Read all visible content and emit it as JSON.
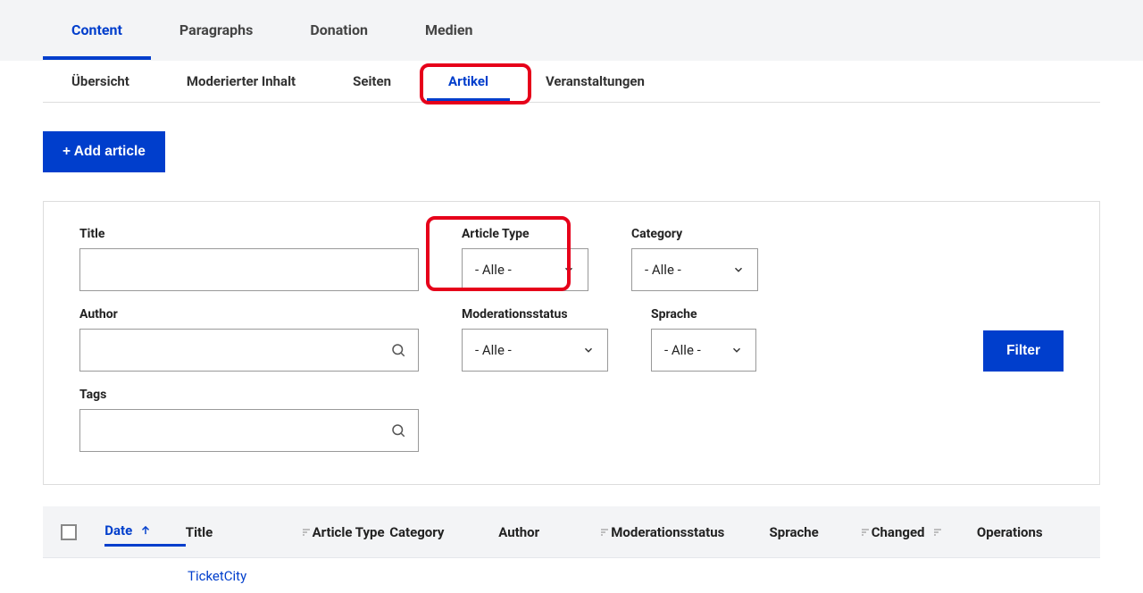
{
  "primaryTabs": {
    "content": "Content",
    "paragraphs": "Paragraphs",
    "donation": "Donation",
    "medien": "Medien"
  },
  "secondaryTabs": {
    "uebersicht": "Übersicht",
    "moderierter": "Moderierter Inhalt",
    "seiten": "Seiten",
    "artikel": "Artikel",
    "veranstaltungen": "Veranstaltungen"
  },
  "addButton": "+ Add article",
  "filters": {
    "title_label": "Title",
    "title_value": "",
    "articleType_label": "Article Type",
    "articleType_value": "- Alle -",
    "category_label": "Category",
    "category_value": "- Alle -",
    "author_label": "Author",
    "author_value": "",
    "moderation_label": "Moderationsstatus",
    "moderation_value": "- Alle -",
    "sprache_label": "Sprache",
    "sprache_value": "- Alle -",
    "tags_label": "Tags",
    "tags_value": "",
    "filterBtn": "Filter"
  },
  "columns": {
    "date": "Date",
    "title": "Title",
    "articleType": "Article Type",
    "category": "Category",
    "author": "Author",
    "moderation": "Moderationsstatus",
    "sprache": "Sprache",
    "changed": "Changed",
    "operations": "Operations"
  },
  "rows": {
    "r0_title": "TicketCity"
  }
}
